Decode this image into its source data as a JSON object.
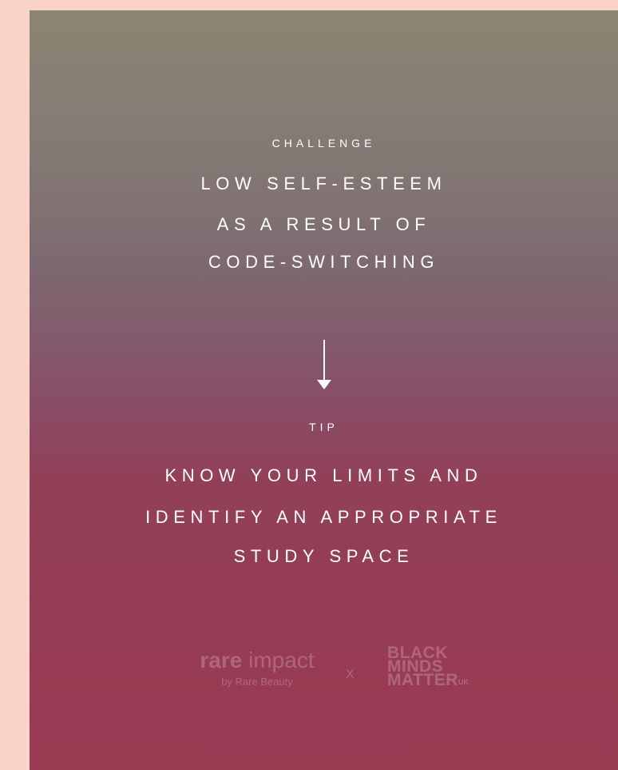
{
  "challenge": {
    "label": "CHALLENGE",
    "lines": [
      "LOW SELF-ESTEEM",
      "AS A RESULT OF",
      "CODE-SWITCHING"
    ]
  },
  "tip": {
    "label": "TIP",
    "lines": [
      "KNOW YOUR LIMITS AND",
      "IDENTIFY AN APPROPRIATE",
      "STUDY SPACE"
    ]
  },
  "arrow": {
    "icon": "arrow-down-icon"
  },
  "logos": {
    "rare_impact": {
      "brand_bold": "rare",
      "brand_light": "impact",
      "tagline": "by Rare Beauty"
    },
    "separator": "X",
    "bmm": {
      "lines": [
        "BLACK",
        "MINDS",
        "MATTER"
      ],
      "suffix": "UK"
    }
  },
  "colors": {
    "page_background": "#f9d3c8",
    "gradient_top": "#8b8573",
    "gradient_bottom": "#9a3b53",
    "text": "#ffffff"
  }
}
